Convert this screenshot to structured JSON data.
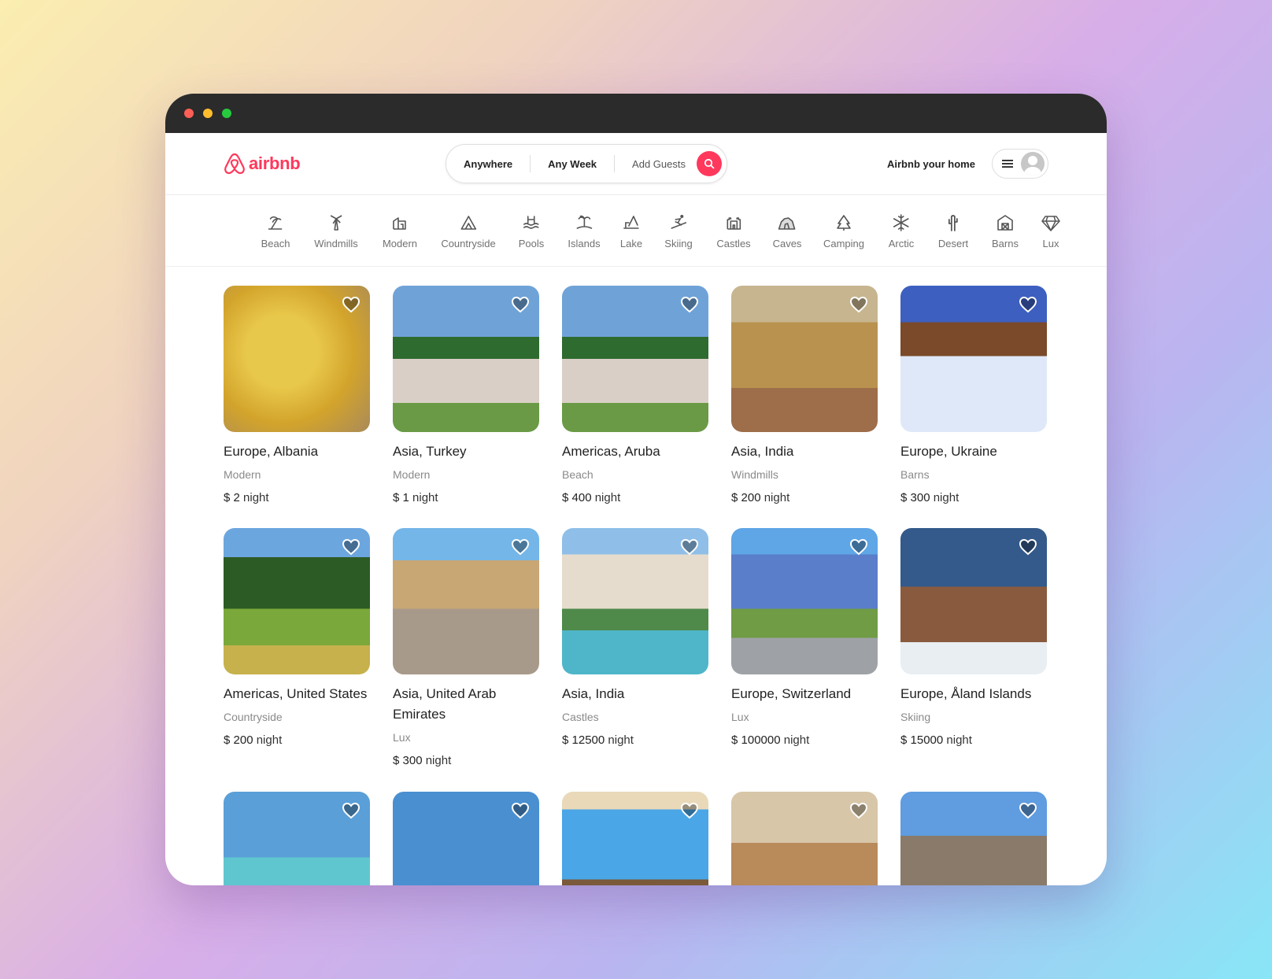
{
  "brand": {
    "name": "airbnb",
    "color": "#ff385c"
  },
  "search": {
    "location": "Anywhere",
    "week": "Any Week",
    "guests": "Add Guests",
    "button_icon": "search-icon"
  },
  "header": {
    "host_link": "Airbnb your home",
    "menu_icon": "hamburger-icon",
    "avatar_icon": "user-avatar-icon"
  },
  "categories": [
    {
      "label": "Beach",
      "icon": "beach-icon"
    },
    {
      "label": "Windmills",
      "icon": "windmill-icon"
    },
    {
      "label": "Modern",
      "icon": "modern-house-icon"
    },
    {
      "label": "Countryside",
      "icon": "countryside-icon"
    },
    {
      "label": "Pools",
      "icon": "pool-icon"
    },
    {
      "label": "Islands",
      "icon": "island-icon"
    },
    {
      "label": "Lake",
      "icon": "lake-icon"
    },
    {
      "label": "Skiing",
      "icon": "skiing-icon"
    },
    {
      "label": "Castles",
      "icon": "castle-icon"
    },
    {
      "label": "Caves",
      "icon": "cave-icon"
    },
    {
      "label": "Camping",
      "icon": "camping-icon"
    },
    {
      "label": "Arctic",
      "icon": "snowflake-icon"
    },
    {
      "label": "Desert",
      "icon": "cactus-icon"
    },
    {
      "label": "Barns",
      "icon": "barn-icon"
    },
    {
      "label": "Lux",
      "icon": "diamond-icon"
    }
  ],
  "listings": [
    {
      "title": "Europe, Albania",
      "category": "Modern",
      "price": "$ 2",
      "unit": "night",
      "image": "pasta dish"
    },
    {
      "title": "Asia, Turkey",
      "category": "Modern",
      "price": "$ 1",
      "unit": "night",
      "image": "suburban house"
    },
    {
      "title": "Americas, Aruba",
      "category": "Beach",
      "price": "$ 400",
      "unit": "night",
      "image": "suburban house"
    },
    {
      "title": "Asia, India",
      "category": "Windmills",
      "price": "$ 200",
      "unit": "night",
      "image": "ornate villa"
    },
    {
      "title": "Europe, Ukraine",
      "category": "Barns",
      "price": "$ 300",
      "unit": "night",
      "image": "snowy barn"
    },
    {
      "title": "Americas, United States",
      "category": "Countryside",
      "price": "$ 200",
      "unit": "night",
      "image": "countryside farm"
    },
    {
      "title": "Asia, United Arab Emirates",
      "category": "Lux",
      "price": "$ 300",
      "unit": "night",
      "image": "resort courtyard"
    },
    {
      "title": "Asia, India",
      "category": "Castles",
      "price": "$ 12500",
      "unit": "night",
      "image": "palace with lake"
    },
    {
      "title": "Europe, Switzerland",
      "category": "Lux",
      "price": "$ 100000",
      "unit": "night",
      "image": "grand hotel"
    },
    {
      "title": "Europe, Åland Islands",
      "category": "Skiing",
      "price": "$ 15000",
      "unit": "night",
      "image": "ski chalet"
    },
    {
      "title": "",
      "category": "",
      "price": "",
      "unit": "",
      "image": "beach house"
    },
    {
      "title": "",
      "category": "",
      "price": "",
      "unit": "",
      "image": "flowering tree"
    },
    {
      "title": "",
      "category": "",
      "price": "",
      "unit": "",
      "image": "ocean view pool"
    },
    {
      "title": "",
      "category": "",
      "price": "",
      "unit": "",
      "image": "desert oasis"
    },
    {
      "title": "",
      "category": "",
      "price": "",
      "unit": "",
      "image": "mountain lodge"
    }
  ],
  "colors": {
    "accent": "#ff385c",
    "titlebar": "#2b2b2b",
    "muted_text": "#717171"
  }
}
